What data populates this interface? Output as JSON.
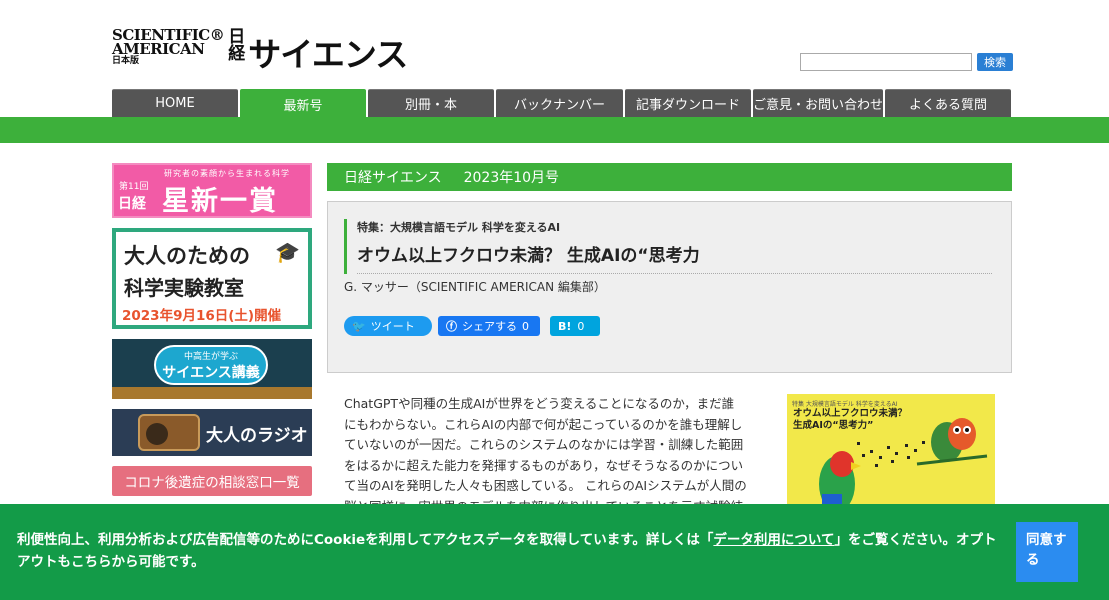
{
  "header": {
    "logo_sa_line1": "SCIENTIFIC®",
    "logo_sa_line2": "AMERICAN",
    "logo_sa_line3": "日本版",
    "logo_nikkei": "日経",
    "logo_science": "サイエンス",
    "search_placeholder": "",
    "search_button": "検索"
  },
  "nav": {
    "tabs": [
      {
        "label": "HOME"
      },
      {
        "label": "最新号"
      },
      {
        "label": "別冊・本"
      },
      {
        "label": "バックナンバー"
      },
      {
        "label": "記事ダウンロード"
      },
      {
        "label": "ご意見・お問い合わせ"
      },
      {
        "label": "よくある質問"
      }
    ]
  },
  "sidebar": {
    "banner1": {
      "sub": "研究者の素顔から生まれる科学",
      "no": "第11回",
      "nikkei": "日経",
      "big": "星新一賞"
    },
    "banner2": {
      "line1": "大人のための",
      "line2": "科学実験教室",
      "date": "2023年9月16日(土)開催"
    },
    "banner3": {
      "small": "中高生が学ぶ",
      "main": "サイエンス講義"
    },
    "banner4": {
      "title": "大人のラジオ"
    },
    "banner5": {
      "label": "コロナ後遺症の相談窓口一覧"
    }
  },
  "main": {
    "issue_name": "日経サイエンス",
    "issue_date": "2023年10月号",
    "feature_label": "特集：大規模言語モデル 科学を変えるAI",
    "title": "オウム以上フクロウ未満？ 生成AIの“思考力",
    "author": "G. マッサー（SCIENTIFIC AMERICAN 編集部）",
    "social": {
      "tweet": "ツイート",
      "share": "シェアする",
      "share_count": "0",
      "hatena": "B!",
      "hatena_count": "0"
    },
    "body_lines": [
      "ChatGPTや同種の生成AIが世界をどう変えることになるのか，まだ誰",
      "にもわからない。これらAIの内部で何が起こっているのかを誰も理解し",
      "ていないのが一因だ。これらのシステムのなかには学習・訓練した範囲",
      "をはるかに超えた能力を発揮するものがあり，なぜそうなるのかについ",
      "て当のAIを発明した人々も困惑している。 これらのAIシステムが人間の",
      "脳と同様に，実世界のモデルを内部に作り出していることを示す試験結"
    ],
    "cover": {
      "header": "特集 大規模言語モデル 科学を変えるAI",
      "title_line1": "オウム以上フクロウ未満？",
      "title_line2": "生成AIの“思考力”"
    }
  },
  "cookie": {
    "text_before": "利便性向上、利用分析および広告配信等のためにCookieを利用してアクセスデータを取得しています。詳しくは「",
    "link": "データ利用について",
    "text_after": "」をご覧ください。オプトアウトもこちらから可能です。",
    "agree_button": "同意する"
  },
  "colors": {
    "accent_green": "#3db03b",
    "cookie_green": "#139b48",
    "nav_gray": "#555555",
    "button_blue": "#2b8cf0"
  }
}
